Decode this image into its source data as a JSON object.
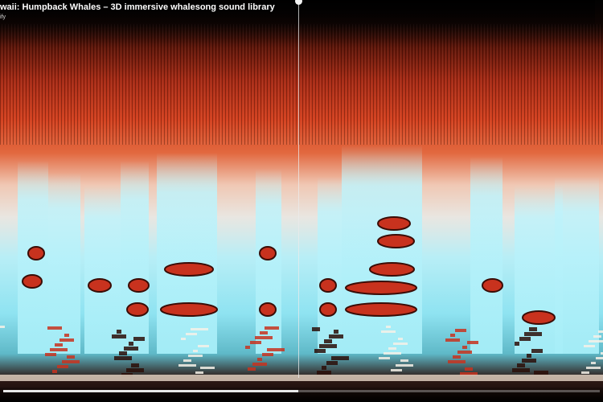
{
  "video": {
    "title": "waii: Humpback Whales – 3D immersive whalesong sound library",
    "channel": "ify",
    "playback_progress": 0.495
  },
  "spectrogram": {
    "colors": {
      "background": "#0b0706",
      "low_energy_red": "#c8321e",
      "mid_energy_cyan": "#8fe8f5",
      "high_energy_white": "#f4fbfd",
      "dark_band": "#3a0c06"
    }
  },
  "controls": {
    "play_icon": "play-icon",
    "volume_icon": "volume-icon",
    "settings_icon": "gear-icon",
    "fullscreen_icon": "fullscreen-icon"
  }
}
